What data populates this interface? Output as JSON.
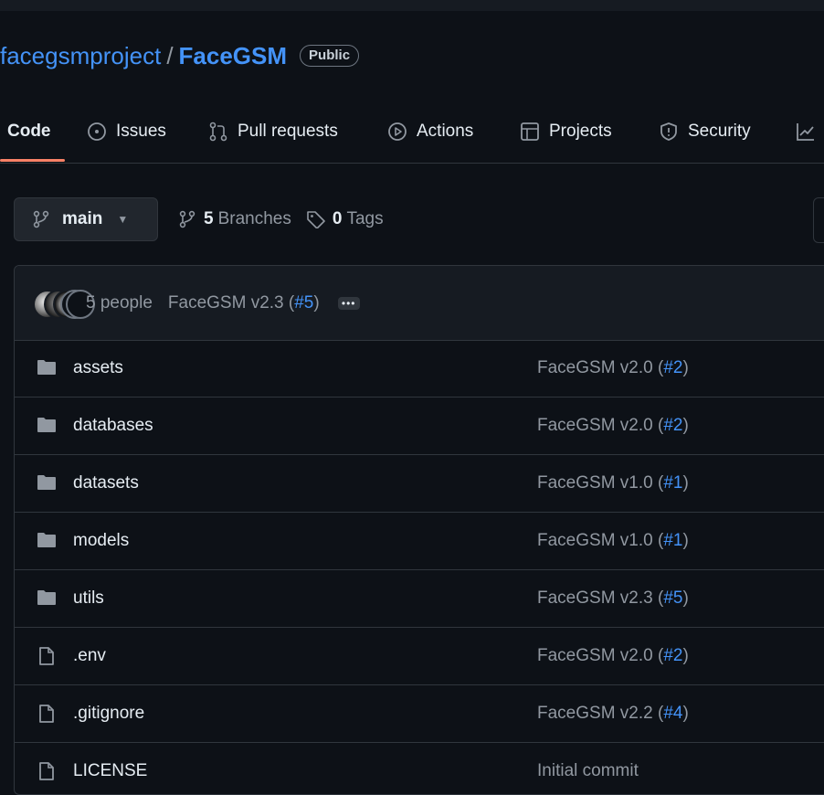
{
  "repo": {
    "owner": "facegsmproject",
    "separator": "/",
    "name": "FaceGSM",
    "visibility": "Public"
  },
  "tabs": [
    {
      "label": "Code",
      "icon": "code-icon",
      "active": true
    },
    {
      "label": "Issues",
      "icon": "issue-icon"
    },
    {
      "label": "Pull requests",
      "icon": "pull-request-icon"
    },
    {
      "label": "Actions",
      "icon": "play-icon"
    },
    {
      "label": "Projects",
      "icon": "table-icon"
    },
    {
      "label": "Security",
      "icon": "shield-icon"
    }
  ],
  "branch": {
    "current": "main",
    "branches_count": "5",
    "branches_label": "Branches",
    "tags_count": "0",
    "tags_label": "Tags"
  },
  "latest_commit": {
    "people": "5 people",
    "message": "FaceGSM v2.3 (",
    "pr": "#5",
    "close": ")"
  },
  "files": [
    {
      "type": "folder",
      "name": "assets",
      "commit": "FaceGSM v2.0 (",
      "pr": "#2",
      "close": ")"
    },
    {
      "type": "folder",
      "name": "databases",
      "commit": "FaceGSM v2.0 (",
      "pr": "#2",
      "close": ")"
    },
    {
      "type": "folder",
      "name": "datasets",
      "commit": "FaceGSM v1.0 (",
      "pr": "#1",
      "close": ")"
    },
    {
      "type": "folder",
      "name": "models",
      "commit": "FaceGSM v1.0 (",
      "pr": "#1",
      "close": ")"
    },
    {
      "type": "folder",
      "name": "utils",
      "commit": "FaceGSM v2.3 (",
      "pr": "#5",
      "close": ")"
    },
    {
      "type": "file",
      "name": ".env",
      "commit": "FaceGSM v2.0 (",
      "pr": "#2",
      "close": ")"
    },
    {
      "type": "file",
      "name": ".gitignore",
      "commit": "FaceGSM v2.2 (",
      "pr": "#4",
      "close": ")"
    },
    {
      "type": "file",
      "name": "LICENSE",
      "commit": "Initial commit",
      "pr": "",
      "close": ""
    }
  ],
  "colors": {
    "background": "#0d1117",
    "link": "#4493f8",
    "muted": "#9198a1",
    "tab_underline": "#f78166"
  }
}
